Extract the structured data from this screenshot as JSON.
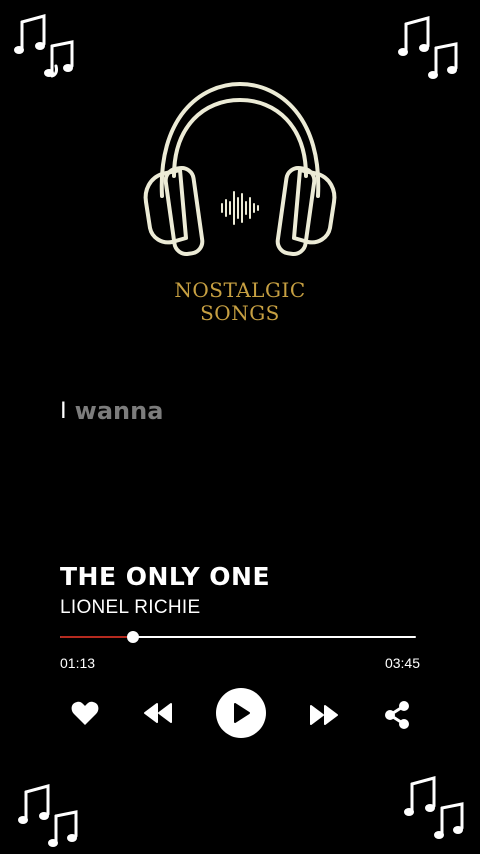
{
  "logo": {
    "line1": "NOSTALGIC",
    "line2": "SONGS",
    "icon": "headphones-icon"
  },
  "lyrics": {
    "current": "I",
    "next": "wanna"
  },
  "track": {
    "title": "THE ONLY ONE",
    "artist": "LIONEL RICHIE"
  },
  "playback": {
    "elapsed": "01:13",
    "duration": "03:45",
    "progress_fraction": 0.205
  },
  "controls": [
    {
      "name": "like-button",
      "icon": "heart-icon"
    },
    {
      "name": "rewind-button",
      "icon": "rewind-icon"
    },
    {
      "name": "play-button",
      "icon": "play-icon"
    },
    {
      "name": "fast-forward-button",
      "icon": "fast-forward-icon"
    },
    {
      "name": "share-button",
      "icon": "share-icon"
    }
  ],
  "colors": {
    "accent_gold": "#c7a042",
    "progress_red": "#b52a1f",
    "background": "#000000",
    "logo_stroke": "#ecebd6"
  }
}
